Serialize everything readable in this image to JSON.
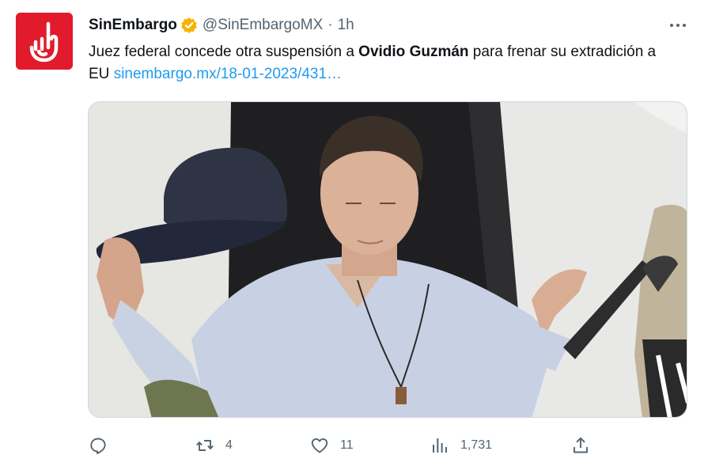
{
  "tweet": {
    "display_name": "SinEmbargo",
    "handle": "@SinEmbargoMX",
    "separator": "·",
    "time": "1h",
    "text_before": "Juez federal concede otra suspensión a ",
    "text_bold": "Ovidio Guzmán",
    "text_after": " para frenar su extradición a EU ",
    "link_text": "sinembargo.mx/18-01-2023/431…"
  },
  "icons": {
    "avatar": "sinembargo-logo",
    "verified": "verified-badge-icon",
    "more": "more-options-icon",
    "reply": "reply-icon",
    "retweet": "retweet-icon",
    "like": "heart-icon",
    "views": "analytics-icon",
    "share": "share-icon"
  },
  "colors": {
    "brand": "#e11b2c",
    "verified": "#f4b400",
    "link": "#1d9bf0",
    "secondary_text": "#536471"
  },
  "actions": {
    "reply_count": "",
    "retweet_count": "4",
    "like_count": "11",
    "views_count": "1,731"
  }
}
